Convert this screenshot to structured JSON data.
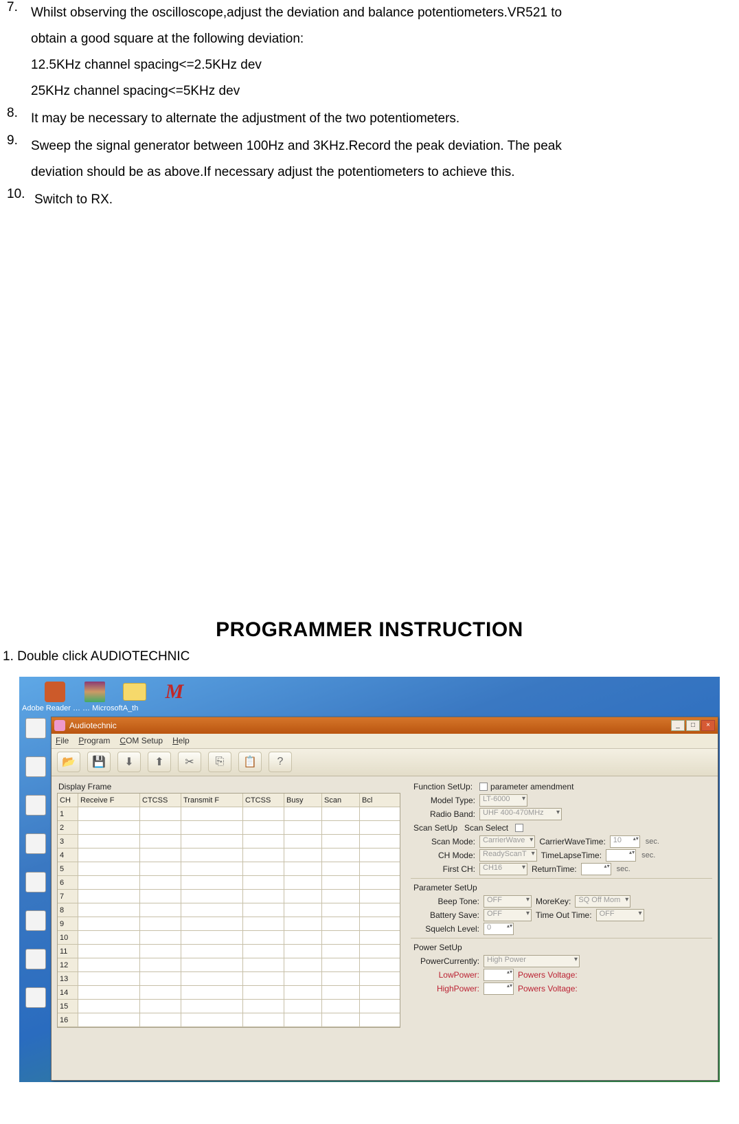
{
  "list": {
    "i7": {
      "num": "7.",
      "line1": "Whilst observing the oscilloscope,adjust the deviation and balance potentiometers.VR521 to",
      "line2": "obtain a good square at the following deviation:",
      "line3": "12.5KHz channel spacing<=2.5KHz dev",
      "line4": "25KHz channel spacing<=5KHz dev"
    },
    "i8": {
      "num": "8.",
      "text": "It may be necessary to alternate the adjustment of the two potentiometers."
    },
    "i9": {
      "num": "9.",
      "line1": "Sweep the signal generator between 100Hz and 3KHz.Record the peak deviation. The peak",
      "line2": "deviation should be as above.If necessary adjust the potentiometers to achieve this."
    },
    "i10": {
      "num": "10.",
      "text": "Switch to RX."
    }
  },
  "heading": "PROGRAMMER INSTRUCTION",
  "step1": "1. Double click AUDIOTECHNIC",
  "shot": {
    "topbar_label": "Adobe Reader … … MicrosoftA_th",
    "app_title": "Audiotechnic",
    "menus": [
      "File",
      "Program",
      "COM Setup",
      "Help"
    ],
    "toolbar_icons": [
      "open-icon",
      "save-icon",
      "read-icon",
      "write-icon",
      "cut-icon",
      "copy-icon",
      "paste-icon",
      "help-icon"
    ],
    "display_frame_label": "Display Frame",
    "grid_headers": [
      "CH",
      "Receive F",
      "CTCSS",
      "Transmit F",
      "CTCSS",
      "Busy",
      "Scan",
      "Bcl"
    ],
    "grid_rows": [
      "1",
      "2",
      "3",
      "4",
      "5",
      "6",
      "7",
      "8",
      "9",
      "10",
      "11",
      "12",
      "13",
      "14",
      "15",
      "16"
    ],
    "function_setup_label": "Function SetUp:",
    "parameter_amend_label": "parameter amendment",
    "model_type_label": "Model Type:",
    "model_type_value": "LT-6000",
    "radio_band_label": "Radio Band:",
    "radio_band_value": "UHF 400-470MHz",
    "scan_setup_label": "Scan SetUp",
    "scan_select_label": "Scan Select",
    "scan_mode_label": "Scan Mode:",
    "scan_mode_value": "CarrierWave",
    "carrier_wave_time_label": "CarrierWaveTime:",
    "carrier_wave_time_value": "10",
    "ch_mode_label": "CH Mode:",
    "ch_mode_value": "ReadyScanT",
    "time_lapse_label": "TimeLapseTime:",
    "first_ch_label": "First CH:",
    "first_ch_value": "CH16",
    "return_time_label": "ReturnTime:",
    "sec_suffix": "sec.",
    "parameter_setup_label": "Parameter SetUp",
    "beep_tone_label": "Beep Tone:",
    "beep_tone_value": "OFF",
    "more_key_label": "MoreKey:",
    "more_key_value": "SQ Off Mom",
    "battery_save_label": "Battery Save:",
    "battery_save_value": "OFF",
    "tot_label": "Time Out Time:",
    "tot_value": "OFF",
    "squelch_level_label": "Squelch Level:",
    "squelch_level_value": "0",
    "power_setup_label": "Power SetUp",
    "power_currently_label": "PowerCurrently:",
    "power_currently_value": "High Power",
    "low_power_label": "LowPower:",
    "low_voltage_label": "Powers Voltage:",
    "high_power_label": "HighPower:",
    "high_voltage_label": "Powers Voltage:"
  }
}
